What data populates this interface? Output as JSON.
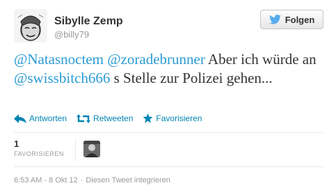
{
  "user": {
    "name": "Sibylle Zemp",
    "handle": "@billy79"
  },
  "follow_button": {
    "label": "Folgen"
  },
  "tweet": {
    "mention_1": "@Natasnoctem",
    "mention_2": "@zoradebrunner",
    "text_1": " Aber ich würde an ",
    "mention_3": "@swissbitch666",
    "text_2": " s Stelle zur Polizei gehen..."
  },
  "actions": {
    "reply": "Antworten",
    "retweet": "Retweeten",
    "favorite": "Favorisieren"
  },
  "stats": {
    "favorites_count": "1",
    "favorites_label": "FAVORISIEREN"
  },
  "footer": {
    "timestamp": "6:53 AM - 8 Okt 12",
    "separator": "·",
    "embed": "Diesen Tweet integrieren"
  },
  "colors": {
    "link": "#2a9bd4",
    "action": "#0084b4",
    "muted": "#999999",
    "twitter_bird": "#55acee"
  },
  "icons": {
    "follow": "twitter-bird-icon",
    "reply": "reply-arrow-icon",
    "retweet": "retweet-icon",
    "favorite": "star-icon"
  }
}
